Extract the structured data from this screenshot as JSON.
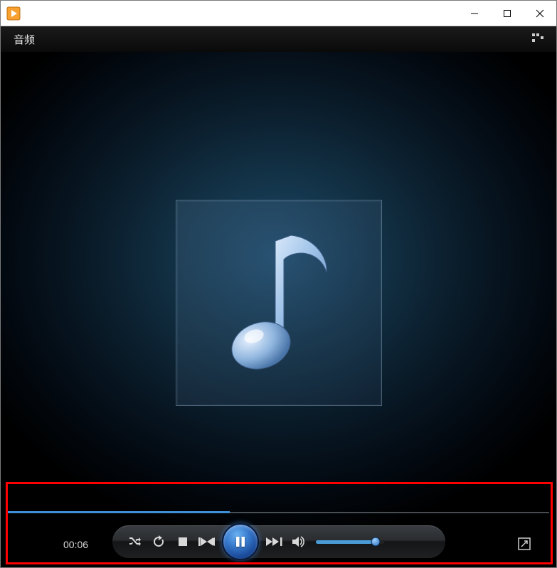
{
  "titlebar": {
    "icon_name": "media-player-icon"
  },
  "window_controls": {
    "minimize": "minimize",
    "maximize": "maximize",
    "close": "close"
  },
  "header": {
    "title": "音频",
    "view_toggle": "library-view"
  },
  "player": {
    "album_art_icon": "music-note-icon",
    "time_elapsed": "00:06",
    "seek_percent": 41,
    "volume_percent": 92
  },
  "controls": {
    "shuffle": "shuffle",
    "repeat": "repeat",
    "stop": "stop",
    "previous": "previous",
    "play_pause": "pause",
    "next": "next",
    "mute": "mute",
    "fullscreen": "fullscreen"
  }
}
